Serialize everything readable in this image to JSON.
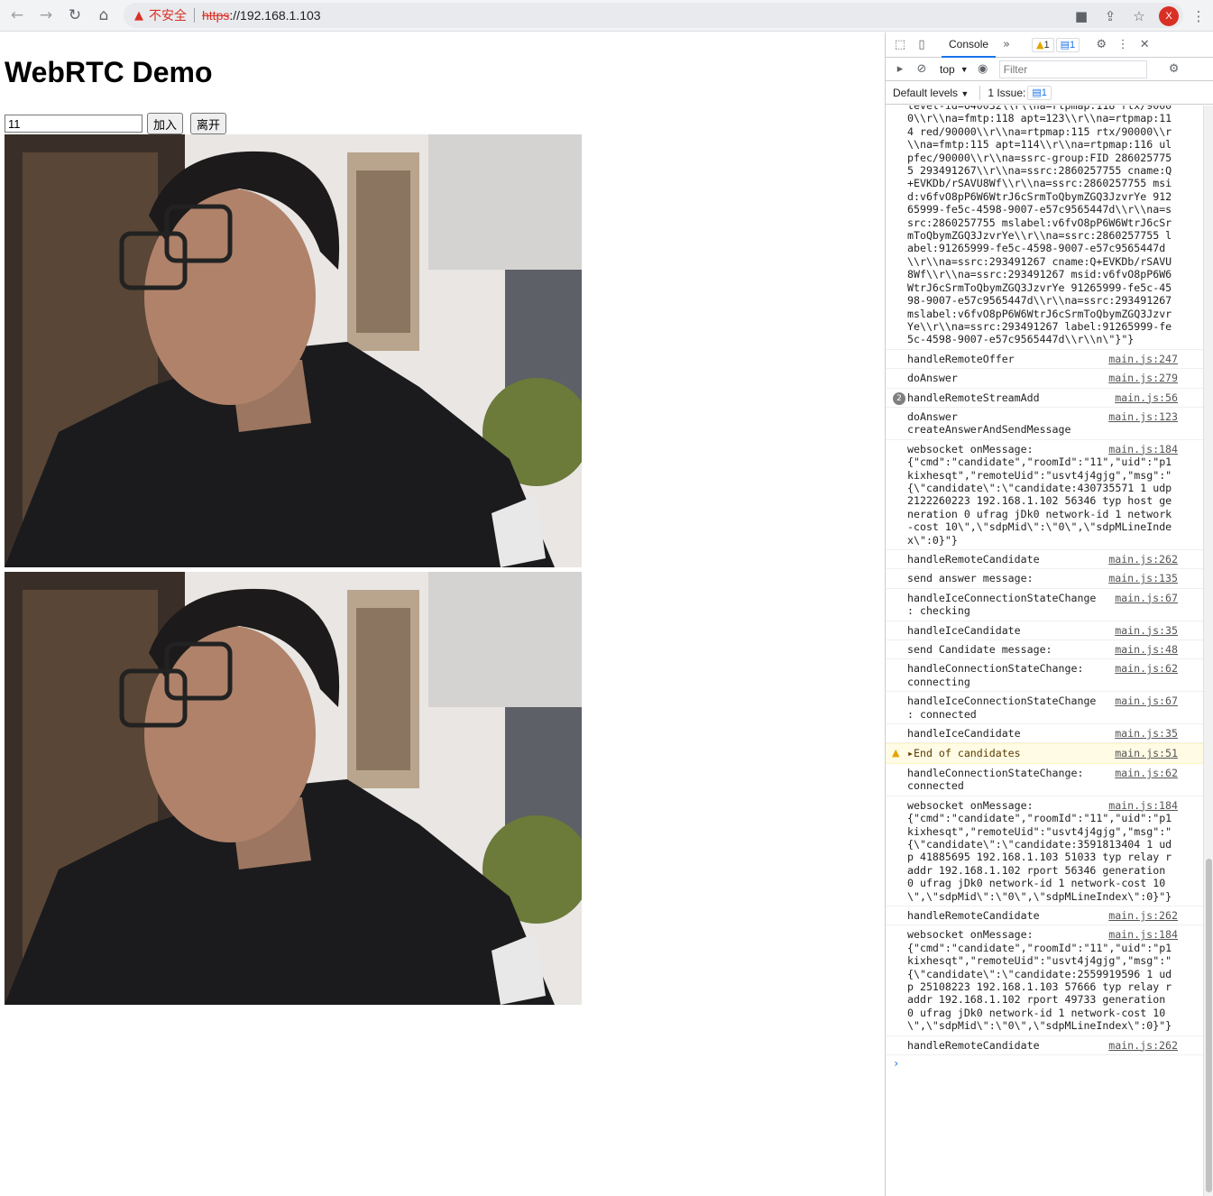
{
  "browser": {
    "insecure_label": "不安全",
    "url_scheme": "https",
    "url_rest": "://192.168.1.103",
    "profile_initial": "X"
  },
  "page": {
    "title": "WebRTC Demo",
    "room_input_value": "11",
    "join_label": "加入",
    "leave_label": "离开"
  },
  "devtools": {
    "tab_console": "Console",
    "warn_count": "1",
    "info_count": "1",
    "context": "top",
    "filter_placeholder": "Filter",
    "levels": "Default levels",
    "issues_label": "1 Issue:",
    "issues_count": "1",
    "sdp_block": "level-id=640032\\\\r\\\\na=rtpmap:118 rtx/90000\\\\r\\\\na=fmtp:118 apt=123\\\\r\\\\na=rtpmap:114 red/90000\\\\r\\\\na=rtpmap:115 rtx/90000\\\\r\\\\na=fmtp:115 apt=114\\\\r\\\\na=rtpmap:116 ulpfec/90000\\\\r\\\\na=ssrc-group:FID 2860257755 293491267\\\\r\\\\na=ssrc:2860257755 cname:Q+EVKDb/rSAVU8Wf\\\\r\\\\na=ssrc:2860257755 msid:v6fvO8pP6W6WtrJ6cSrmToQbymZGQ3JzvrYe 91265999-fe5c-4598-9007-e57c9565447d\\\\r\\\\na=ssrc:2860257755 mslabel:v6fvO8pP6W6WtrJ6cSrmToQbymZGQ3JzvrYe\\\\r\\\\na=ssrc:2860257755 label:91265999-fe5c-4598-9007-e57c9565447d\\\\r\\\\na=ssrc:293491267 cname:Q+EVKDb/rSAVU8Wf\\\\r\\\\na=ssrc:293491267 msid:v6fvO8pP6W6WtrJ6cSrmToQbymZGQ3JzvrYe 91265999-fe5c-4598-9007-e57c9565447d\\\\r\\\\na=ssrc:293491267 mslabel:v6fvO8pP6W6WtrJ6cSrmToQbymZGQ3JzvrYe\\\\r\\\\na=ssrc:293491267 label:91265999-fe5c-4598-9007-e57c9565447d\\\\r\\\\n\\\"}\"}",
    "messages": [
      {
        "text": "handleRemoteOffer",
        "src": "main.js:247"
      },
      {
        "text": "doAnswer",
        "src": "main.js:279"
      },
      {
        "text": "handleRemoteStreamAdd",
        "src": "main.js:56",
        "count": "2"
      },
      {
        "text": "doAnswer\ncreateAnswerAndSendMessage",
        "src": "main.js:123"
      },
      {
        "text": "websocket onMessage:\n{\"cmd\":\"candidate\",\"roomId\":\"11\",\"uid\":\"p1kixhesqt\",\"remoteUid\":\"usvt4j4gjg\",\"msg\":\"{\\\"candidate\\\":\\\"candidate:430735571 1 udp 2122260223 192.168.1.102 56346 typ host generation 0 ufrag jDk0 network-id 1 network-cost 10\\\",\\\"sdpMid\\\":\\\"0\\\",\\\"sdpMLineIndex\\\":0}\"}",
        "src": "main.js:184"
      },
      {
        "text": "handleRemoteCandidate",
        "src": "main.js:262"
      },
      {
        "text": "send answer message:",
        "src": "main.js:135"
      },
      {
        "text": "handleIceConnectionStateChange\n: checking",
        "src": "main.js:67"
      },
      {
        "text": "handleIceCandidate",
        "src": "main.js:35"
      },
      {
        "text": "send Candidate message:",
        "src": "main.js:48"
      },
      {
        "text": "handleConnectionStateChange:\nconnecting",
        "src": "main.js:62"
      },
      {
        "text": "handleIceConnectionStateChange\n: connected",
        "src": "main.js:67"
      },
      {
        "text": "handleIceCandidate",
        "src": "main.js:35"
      },
      {
        "text": "▸End of candidates",
        "src": "main.js:51",
        "level": "warn"
      },
      {
        "text": "handleConnectionStateChange:\nconnected",
        "src": "main.js:62"
      },
      {
        "text": "websocket onMessage:\n{\"cmd\":\"candidate\",\"roomId\":\"11\",\"uid\":\"p1kixhesqt\",\"remoteUid\":\"usvt4j4gjg\",\"msg\":\"{\\\"candidate\\\":\\\"candidate:3591813404 1 udp 41885695 192.168.1.103 51033 typ relay raddr 192.168.1.102 rport 56346 generation 0 ufrag jDk0 network-id 1 network-cost 10\\\",\\\"sdpMid\\\":\\\"0\\\",\\\"sdpMLineIndex\\\":0}\"}",
        "src": "main.js:184"
      },
      {
        "text": "handleRemoteCandidate",
        "src": "main.js:262"
      },
      {
        "text": "websocket onMessage:\n{\"cmd\":\"candidate\",\"roomId\":\"11\",\"uid\":\"p1kixhesqt\",\"remoteUid\":\"usvt4j4gjg\",\"msg\":\"{\\\"candidate\\\":\\\"candidate:2559919596 1 udp 25108223 192.168.1.103 57666 typ relay raddr 192.168.1.102 rport 49733 generation 0 ufrag jDk0 network-id 1 network-cost 10\\\",\\\"sdpMid\\\":\\\"0\\\",\\\"sdpMLineIndex\\\":0}\"}",
        "src": "main.js:184"
      },
      {
        "text": "handleRemoteCandidate",
        "src": "main.js:262"
      }
    ]
  },
  "icons": {
    "back": "back-arrow-icon",
    "forward": "forward-arrow-icon",
    "reload": "reload-icon",
    "home": "home-icon",
    "warning": "warning-icon",
    "camera": "camera-icon",
    "share": "share-icon",
    "star": "star-icon",
    "menu": "kebab-menu-icon"
  }
}
